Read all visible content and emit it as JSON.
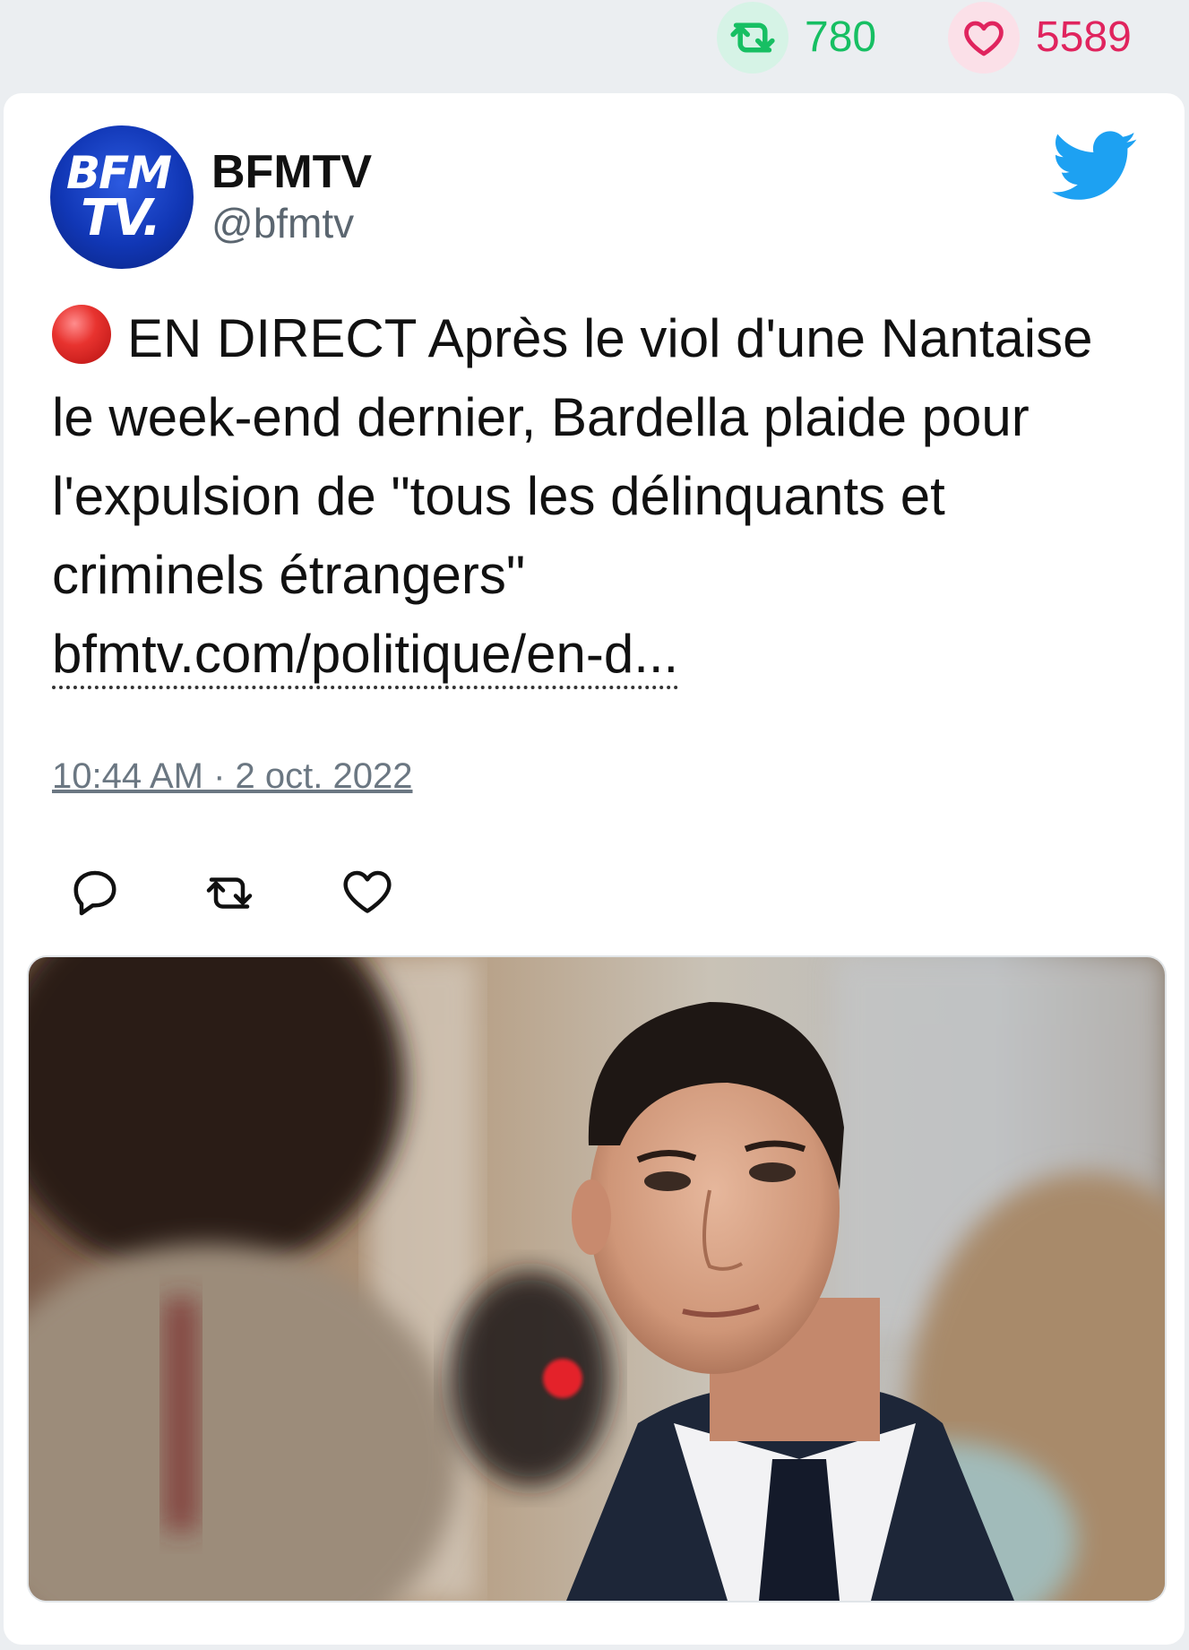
{
  "stats": {
    "retweets": "780",
    "likes": "5589",
    "retweet_icon": "retweet-icon",
    "like_icon": "heart-icon"
  },
  "tweet": {
    "author_name": "BFMTV",
    "author_handle": "@bfmtv",
    "avatar_text_line1": "BFM",
    "avatar_text_line2": "TV.",
    "text": "EN DIRECT Après le viol d'une Nantaise le week-end dernier, Bardella plaide pour l'expulsion de \"tous les délinquants et criminels étrangers\"",
    "link": "bfmtv.com/politique/en-d...",
    "timestamp": "10:44 AM · 2 oct. 2022",
    "icons": {
      "reply": "reply-icon",
      "retweet": "retweet-icon",
      "like": "heart-icon",
      "bird": "twitter-bird-icon",
      "live": "red-circle-icon"
    }
  },
  "colors": {
    "retweet": "#17bf63",
    "like": "#e0245e",
    "twitter_blue": "#1da1f2",
    "avatar_blue": "#1137b6"
  }
}
